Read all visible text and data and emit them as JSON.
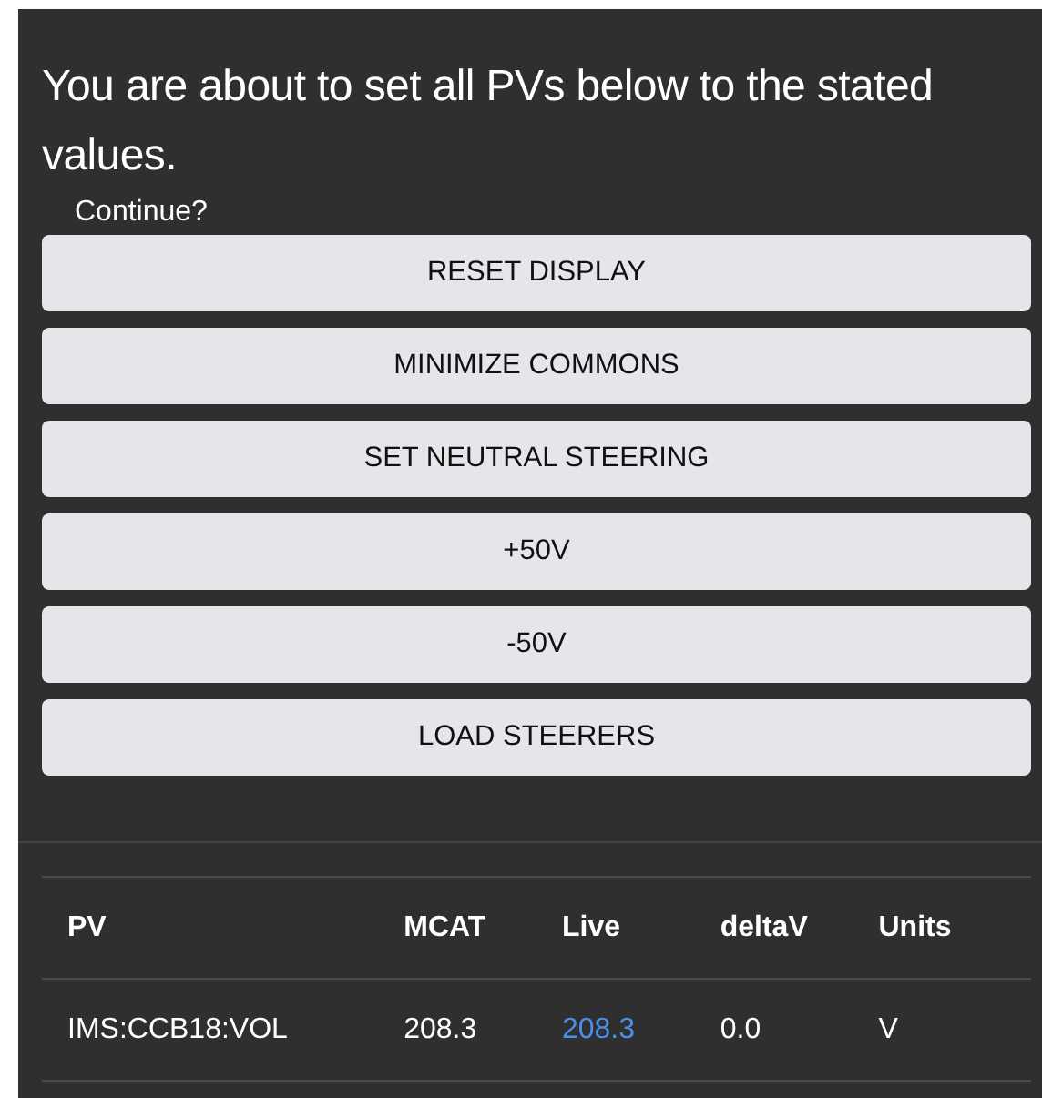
{
  "heading": "You are about to set all PVs below to the stated values.",
  "prompt": "Continue?",
  "buttons": [
    "RESET DISPLAY",
    "MINIMIZE COMMONS",
    "SET NEUTRAL STEERING",
    "+50V",
    "-50V",
    "LOAD STEERERS"
  ],
  "table": {
    "columns": [
      "PV",
      "MCAT",
      "Live",
      "deltaV",
      "Units"
    ],
    "rows": [
      {
        "pv": "IMS:CCB18:VOL",
        "mcat": "208.3",
        "live": "208.3",
        "deltav": "0.0",
        "units": "V"
      }
    ]
  }
}
